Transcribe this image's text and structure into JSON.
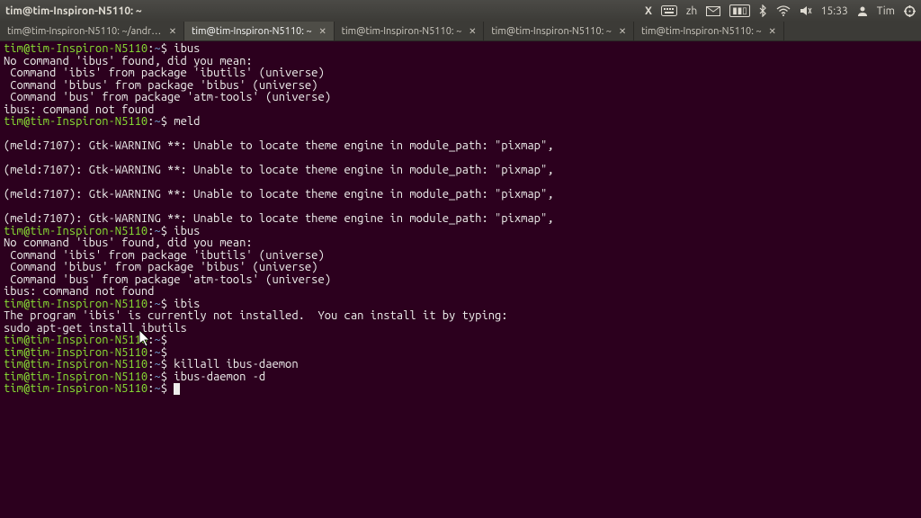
{
  "menubar": {
    "title": "tim@tim-Inspiron-N5110: ~",
    "input_lang": "zh",
    "time": "15:33",
    "username": "Tim"
  },
  "tabs": [
    {
      "label": "tim@tim-Inspiron-N5110: ~/andro...",
      "active": false
    },
    {
      "label": "tim@tim-Inspiron-N5110: ~",
      "active": true
    },
    {
      "label": "tim@tim-Inspiron-N5110: ~",
      "active": false
    },
    {
      "label": "tim@tim-Inspiron-N5110: ~",
      "active": false
    },
    {
      "label": "tim@tim-Inspiron-N5110: ~",
      "active": false
    }
  ],
  "prompt": {
    "userhost": "tim@tim-Inspiron-N5110",
    "sep": ":",
    "path": "~",
    "suffix": "$ "
  },
  "lines": [
    {
      "type": "prompt",
      "cmd": "ibus"
    },
    {
      "type": "out",
      "text": "No command 'ibus' found, did you mean:"
    },
    {
      "type": "out",
      "text": " Command 'ibis' from package 'ibutils' (universe)"
    },
    {
      "type": "out",
      "text": " Command 'bibus' from package 'bibus' (universe)"
    },
    {
      "type": "out",
      "text": " Command 'bus' from package 'atm-tools' (universe)"
    },
    {
      "type": "out",
      "text": "ibus: command not found"
    },
    {
      "type": "prompt",
      "cmd": "meld"
    },
    {
      "type": "out",
      "text": ""
    },
    {
      "type": "out",
      "text": "(meld:7107): Gtk-WARNING **: Unable to locate theme engine in module_path: \"pixmap\","
    },
    {
      "type": "out",
      "text": ""
    },
    {
      "type": "out",
      "text": "(meld:7107): Gtk-WARNING **: Unable to locate theme engine in module_path: \"pixmap\","
    },
    {
      "type": "out",
      "text": ""
    },
    {
      "type": "out",
      "text": "(meld:7107): Gtk-WARNING **: Unable to locate theme engine in module_path: \"pixmap\","
    },
    {
      "type": "out",
      "text": ""
    },
    {
      "type": "out",
      "text": "(meld:7107): Gtk-WARNING **: Unable to locate theme engine in module_path: \"pixmap\","
    },
    {
      "type": "prompt",
      "cmd": "ibus"
    },
    {
      "type": "out",
      "text": "No command 'ibus' found, did you mean:"
    },
    {
      "type": "out",
      "text": " Command 'ibis' from package 'ibutils' (universe)"
    },
    {
      "type": "out",
      "text": " Command 'bibus' from package 'bibus' (universe)"
    },
    {
      "type": "out",
      "text": " Command 'bus' from package 'atm-tools' (universe)"
    },
    {
      "type": "out",
      "text": "ibus: command not found"
    },
    {
      "type": "prompt",
      "cmd": "ibis"
    },
    {
      "type": "out",
      "text": "The program 'ibis' is currently not installed.  You can install it by typing:"
    },
    {
      "type": "out",
      "text": "sudo apt-get install ibutils"
    },
    {
      "type": "prompt",
      "cmd": ""
    },
    {
      "type": "prompt",
      "cmd": ""
    },
    {
      "type": "prompt",
      "cmd": "killall ibus-daemon"
    },
    {
      "type": "prompt",
      "cmd": "ibus-daemon -d"
    },
    {
      "type": "prompt-cursor",
      "cmd": ""
    }
  ]
}
